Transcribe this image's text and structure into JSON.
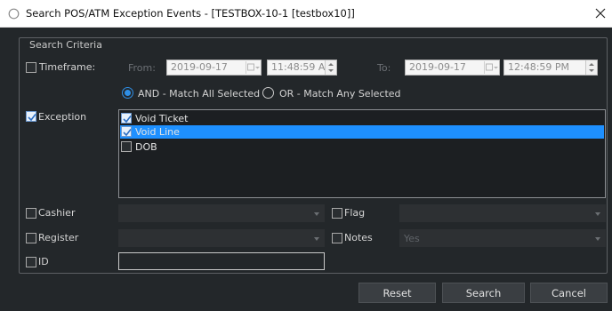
{
  "window": {
    "title": "Search POS/ATM Exception Events - [TESTBOX-10-1 [testbox10]]"
  },
  "group": {
    "legend": "Search Criteria"
  },
  "timeframe": {
    "label": "Timeframe:",
    "checked": false,
    "from_label": "From:",
    "from_date": "2019-09-17",
    "from_time": "11:48:59 AM",
    "to_label": "To:",
    "to_date": "2019-09-17",
    "to_time": "12:48:59 PM"
  },
  "match": {
    "and_label": "AND - Match All Selected",
    "or_label": "OR - Match Any Selected",
    "selected": "AND"
  },
  "exception": {
    "label": "Exception",
    "checked": true,
    "items": [
      {
        "label": "Void Ticket",
        "checked": true,
        "selected": false
      },
      {
        "label": "Void Line",
        "checked": true,
        "selected": true
      },
      {
        "label": "DOB",
        "checked": false,
        "selected": false
      }
    ]
  },
  "cashier": {
    "label": "Cashier",
    "checked": false,
    "value": ""
  },
  "flag": {
    "label": "Flag",
    "checked": false,
    "value": ""
  },
  "register": {
    "label": "Register",
    "checked": false,
    "value": ""
  },
  "notes": {
    "label": "Notes",
    "checked": false,
    "value": "Yes"
  },
  "id": {
    "label": "ID",
    "checked": false,
    "value": ""
  },
  "buttons": {
    "reset": "Reset",
    "search": "Search",
    "cancel": "Cancel"
  },
  "colors": {
    "background": "#23272a",
    "selection": "#1e90ff",
    "titlebar": "#ffffff"
  },
  "icons": {
    "title": "search-icon",
    "close": "close-icon",
    "calendar": "calendar-dropdown-icon",
    "spinner": "spinner-icon",
    "combo": "chevron-down-icon"
  }
}
